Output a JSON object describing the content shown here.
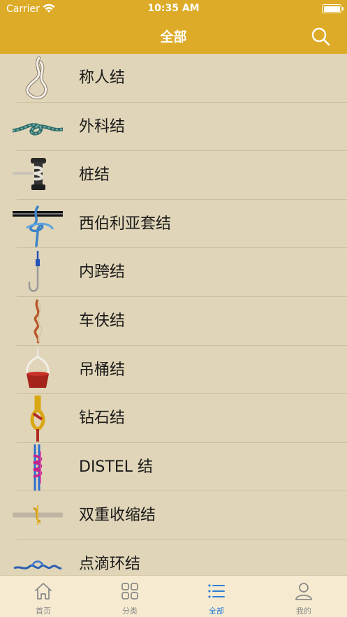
{
  "status_bar": {
    "carrier": "Carrier",
    "time": "10:35 AM"
  },
  "nav": {
    "title": "全部",
    "search_icon": "search-icon"
  },
  "list": {
    "items": [
      {
        "label": "称人结",
        "icon": "bowline-knot-icon"
      },
      {
        "label": "外科结",
        "icon": "surgeons-knot-icon"
      },
      {
        "label": "桩结",
        "icon": "bollard-hitch-icon"
      },
      {
        "label": "西伯利亚套结",
        "icon": "siberian-hitch-icon"
      },
      {
        "label": "内跨结",
        "icon": "hook-knot-icon"
      },
      {
        "label": "车伕结",
        "icon": "truckers-hitch-icon"
      },
      {
        "label": "吊桶结",
        "icon": "bucket-hitch-icon"
      },
      {
        "label": "钻石结",
        "icon": "diamond-knot-icon"
      },
      {
        "label": "DISTEL 结",
        "icon": "distel-hitch-icon"
      },
      {
        "label": "双重收缩结",
        "icon": "double-sheepshank-icon"
      },
      {
        "label": "点滴环结",
        "icon": "dropper-loop-icon"
      }
    ]
  },
  "tabs": [
    {
      "label": "首页",
      "icon": "home-icon",
      "active": false
    },
    {
      "label": "分类",
      "icon": "grid-icon",
      "active": false
    },
    {
      "label": "全部",
      "icon": "list-icon",
      "active": true
    },
    {
      "label": "我的",
      "icon": "user-icon",
      "active": false
    }
  ],
  "colors": {
    "accent": "#ddab27",
    "background": "#e0d5b8",
    "tab_bar": "#f6ebd0",
    "tab_active": "#2f7fd6",
    "tab_inactive": "#8a8a8a"
  }
}
